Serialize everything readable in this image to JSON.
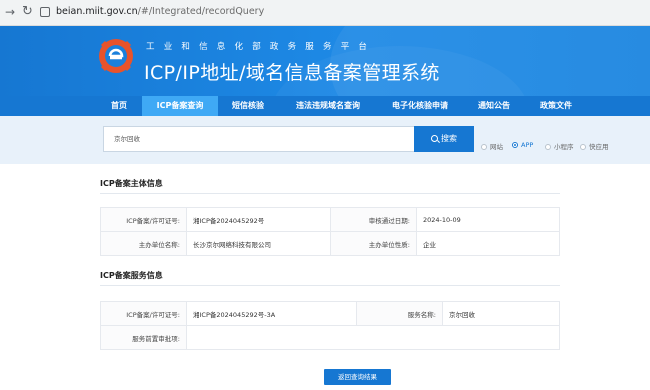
{
  "browser": {
    "url_host": "beian.miit.gov.cn",
    "url_path": "/#/Integrated/recordQuery"
  },
  "banner": {
    "subtitle": "工业和信息化部政务服务平台",
    "title": "ICP/IP地址/域名信息备案管理系统"
  },
  "nav": {
    "items": [
      "首页",
      "ICP备案查询",
      "短信核验",
      "违法违规域名查询",
      "电子化核验申请",
      "通知公告",
      "政策文件"
    ],
    "active_index": 1
  },
  "search": {
    "value": "京尔回收",
    "button_label": "搜索",
    "options": [
      "网站",
      "APP",
      "小程序",
      "快应用"
    ],
    "selected": "APP"
  },
  "section1": {
    "title": "ICP备案主体信息",
    "rows": [
      {
        "l1": "ICP备案/许可证号:",
        "v1": "湘ICP备2024045292号",
        "l2": "审核通过日期:",
        "v2": "2024-10-09"
      },
      {
        "l1": "主办单位名称:",
        "v1": "长沙京尔网络科技有限公司",
        "l2": "主办单位性质:",
        "v2": "企业"
      }
    ]
  },
  "section2": {
    "title": "ICP备案服务信息",
    "rows": [
      {
        "l1": "ICP备案/许可证号:",
        "v1": "湘ICP备2024045292号-3A",
        "l2": "服务名称:",
        "v2": "京尔回收"
      },
      {
        "l1": "服务前置审批项:",
        "v1": "",
        "l2": "",
        "v2": ""
      }
    ]
  },
  "back_button": "返回查询结果",
  "colors": {
    "primary": "#1677d2",
    "nav_active": "#3fa9f5",
    "search_band": "#e8f1fa"
  }
}
